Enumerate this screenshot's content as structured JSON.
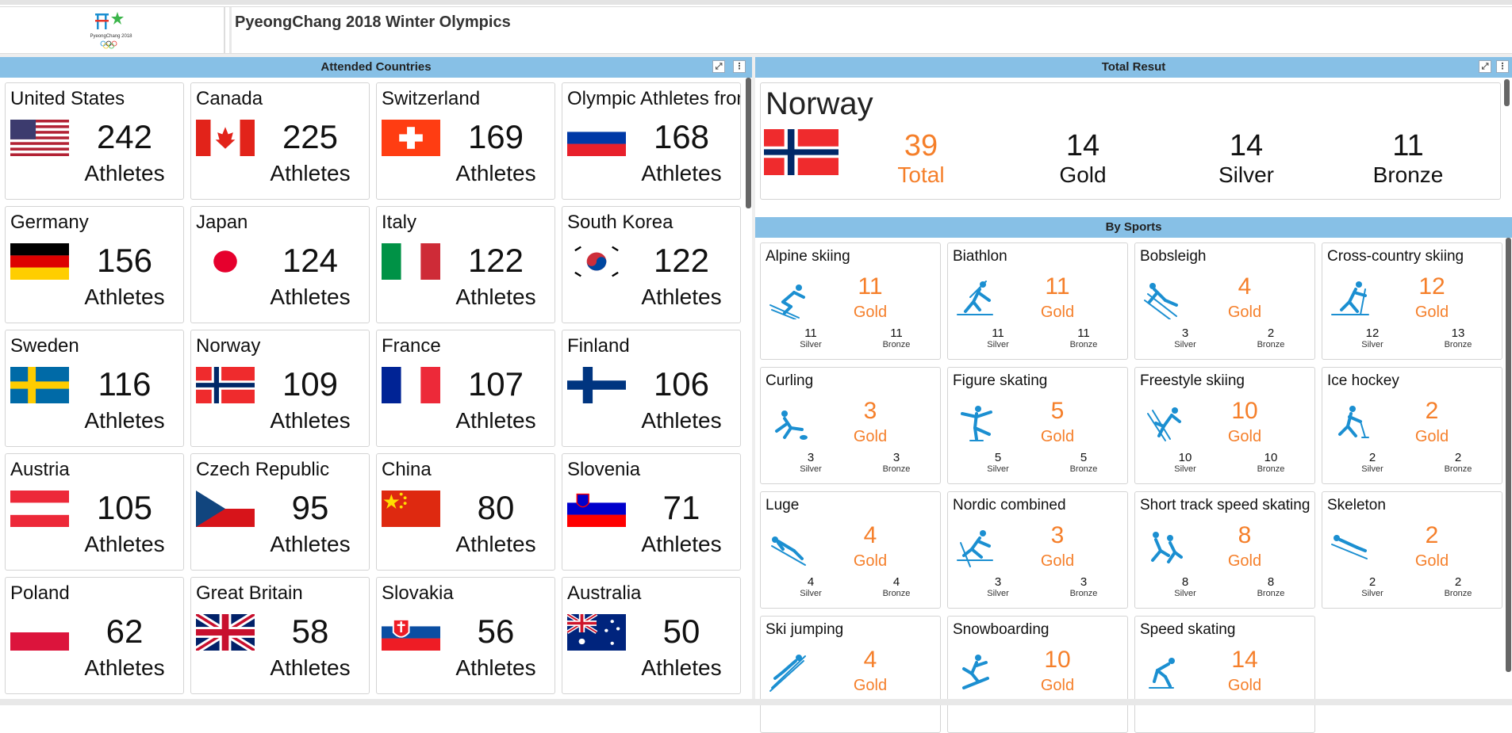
{
  "app": {
    "title": "PyeongChang 2018 Winter Olympics",
    "logo_text": "PyeongChang 2018"
  },
  "countries_panel": {
    "title": "Attended Countries",
    "athletes_label": "Athletes",
    "items": [
      {
        "name": "United States",
        "count": "242",
        "flag": "us-flag"
      },
      {
        "name": "Canada",
        "count": "225",
        "flag": "canada-flag"
      },
      {
        "name": "Switzerland",
        "count": "169",
        "flag": "switzerland-flag"
      },
      {
        "name": "Olympic Athletes from Russia",
        "count": "168",
        "flag": "russia-flag"
      },
      {
        "name": "Germany",
        "count": "156",
        "flag": "germany-flag"
      },
      {
        "name": "Japan",
        "count": "124",
        "flag": "japan-flag"
      },
      {
        "name": "Italy",
        "count": "122",
        "flag": "italy-flag"
      },
      {
        "name": "South Korea",
        "count": "122",
        "flag": "south-korea-flag"
      },
      {
        "name": "Sweden",
        "count": "116",
        "flag": "sweden-flag"
      },
      {
        "name": "Norway",
        "count": "109",
        "flag": "norway-flag"
      },
      {
        "name": "France",
        "count": "107",
        "flag": "france-flag"
      },
      {
        "name": "Finland",
        "count": "106",
        "flag": "finland-flag"
      },
      {
        "name": "Austria",
        "count": "105",
        "flag": "austria-flag"
      },
      {
        "name": "Czech Republic",
        "count": "95",
        "flag": "czech-flag"
      },
      {
        "name": "China",
        "count": "80",
        "flag": "china-flag"
      },
      {
        "name": "Slovenia",
        "count": "71",
        "flag": "slovenia-flag"
      },
      {
        "name": "Poland",
        "count": "62",
        "flag": "poland-flag"
      },
      {
        "name": "Great Britain",
        "count": "58",
        "flag": "uk-flag"
      },
      {
        "name": "Slovakia",
        "count": "56",
        "flag": "slovakia-flag"
      },
      {
        "name": "Australia",
        "count": "50",
        "flag": "australia-flag"
      }
    ]
  },
  "total_panel": {
    "title": "Total Resut",
    "country": "Norway",
    "flag": "norway-flag",
    "total": "39",
    "total_label": "Total",
    "gold": "14",
    "gold_label": "Gold",
    "silver": "14",
    "silver_label": "Silver",
    "bronze": "11",
    "bronze_label": "Bronze"
  },
  "sports_panel": {
    "title": "By Sports",
    "gold_label": "Gold",
    "silver_label": "Silver",
    "bronze_label": "Bronze",
    "items": [
      {
        "name": "Alpine skiing",
        "gold": "11",
        "silver": "11",
        "bronze": "11",
        "icon": "alpine-skiing-icon"
      },
      {
        "name": "Biathlon",
        "gold": "11",
        "silver": "11",
        "bronze": "11",
        "icon": "biathlon-icon"
      },
      {
        "name": "Bobsleigh",
        "gold": "4",
        "silver": "3",
        "bronze": "2",
        "icon": "bobsleigh-icon"
      },
      {
        "name": "Cross-country skiing",
        "gold": "12",
        "silver": "12",
        "bronze": "13",
        "icon": "cross-country-skiing-icon"
      },
      {
        "name": "Curling",
        "gold": "3",
        "silver": "3",
        "bronze": "3",
        "icon": "curling-icon"
      },
      {
        "name": "Figure skating",
        "gold": "5",
        "silver": "5",
        "bronze": "5",
        "icon": "figure-skating-icon"
      },
      {
        "name": "Freestyle skiing",
        "gold": "10",
        "silver": "10",
        "bronze": "10",
        "icon": "freestyle-skiing-icon"
      },
      {
        "name": "Ice hockey",
        "gold": "2",
        "silver": "2",
        "bronze": "2",
        "icon": "ice-hockey-icon"
      },
      {
        "name": "Luge",
        "gold": "4",
        "silver": "4",
        "bronze": "4",
        "icon": "luge-icon"
      },
      {
        "name": "Nordic combined",
        "gold": "3",
        "silver": "3",
        "bronze": "3",
        "icon": "nordic-combined-icon"
      },
      {
        "name": "Short track speed skating",
        "gold": "8",
        "silver": "8",
        "bronze": "8",
        "icon": "short-track-icon"
      },
      {
        "name": "Skeleton",
        "gold": "2",
        "silver": "2",
        "bronze": "2",
        "icon": "skeleton-icon"
      },
      {
        "name": "Ski jumping",
        "gold": "4",
        "silver": "",
        "bronze": "",
        "icon": "ski-jumping-icon"
      },
      {
        "name": "Snowboarding",
        "gold": "10",
        "silver": "",
        "bronze": "",
        "icon": "snowboarding-icon"
      },
      {
        "name": "Speed skating",
        "gold": "14",
        "silver": "",
        "bronze": "",
        "icon": "speed-skating-icon"
      }
    ]
  },
  "colors": {
    "accent": "#87c0e6",
    "medal_orange": "#f57f2a",
    "pictogram_blue": "#1b8fd1"
  }
}
